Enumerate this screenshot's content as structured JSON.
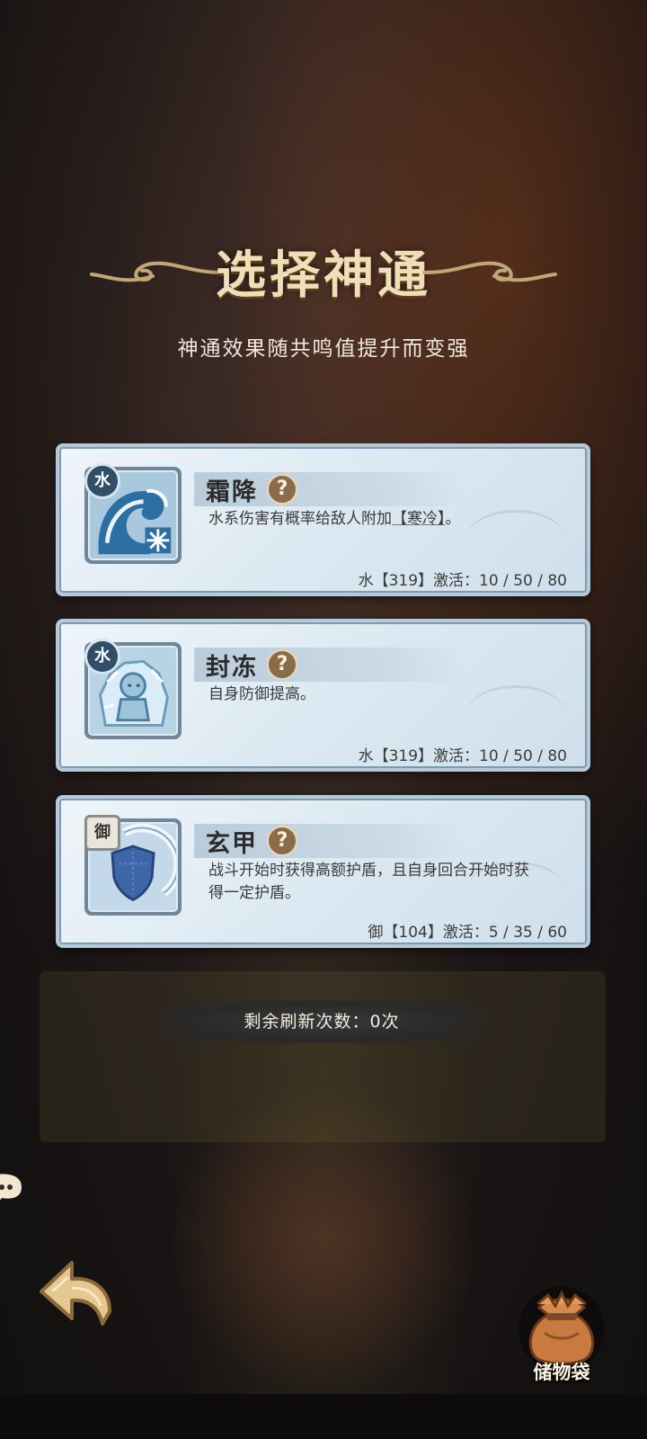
{
  "title": "选择神通",
  "subtitle": "神通效果随共鸣值提升而变强",
  "cards": [
    {
      "element_badge": "水",
      "icon": "wave-frost-icon",
      "name": "霜降",
      "help_label": "?",
      "desc_prefix": "水系伤害有概率给敌人附加",
      "desc_highlight": "【寒冷】",
      "desc_suffix": "。",
      "activation": "水【319】激活：10 / 50 / 80"
    },
    {
      "element_badge": "水",
      "icon": "ice-statue-icon",
      "name": "封冻",
      "help_label": "?",
      "desc_prefix": "自身防御提高。",
      "desc_highlight": "",
      "desc_suffix": "",
      "activation": "水【319】激活：10 / 50 / 80"
    },
    {
      "element_badge": "御",
      "icon": "shield-icon",
      "name": "玄甲",
      "help_label": "?",
      "desc_prefix": "战斗开始时获得高额护盾，且自身回合开始时获得一定护盾。",
      "desc_highlight": "",
      "desc_suffix": "",
      "activation": "御【104】激活：5 / 35 / 60"
    }
  ],
  "refresh_text": "剩余刷新次数：0次",
  "storage_bag_label": "储物袋",
  "colors": {
    "card_bg": "#e3eef5",
    "title_gold": "#f0dfb6",
    "help_brown": "#8a6b4a"
  }
}
